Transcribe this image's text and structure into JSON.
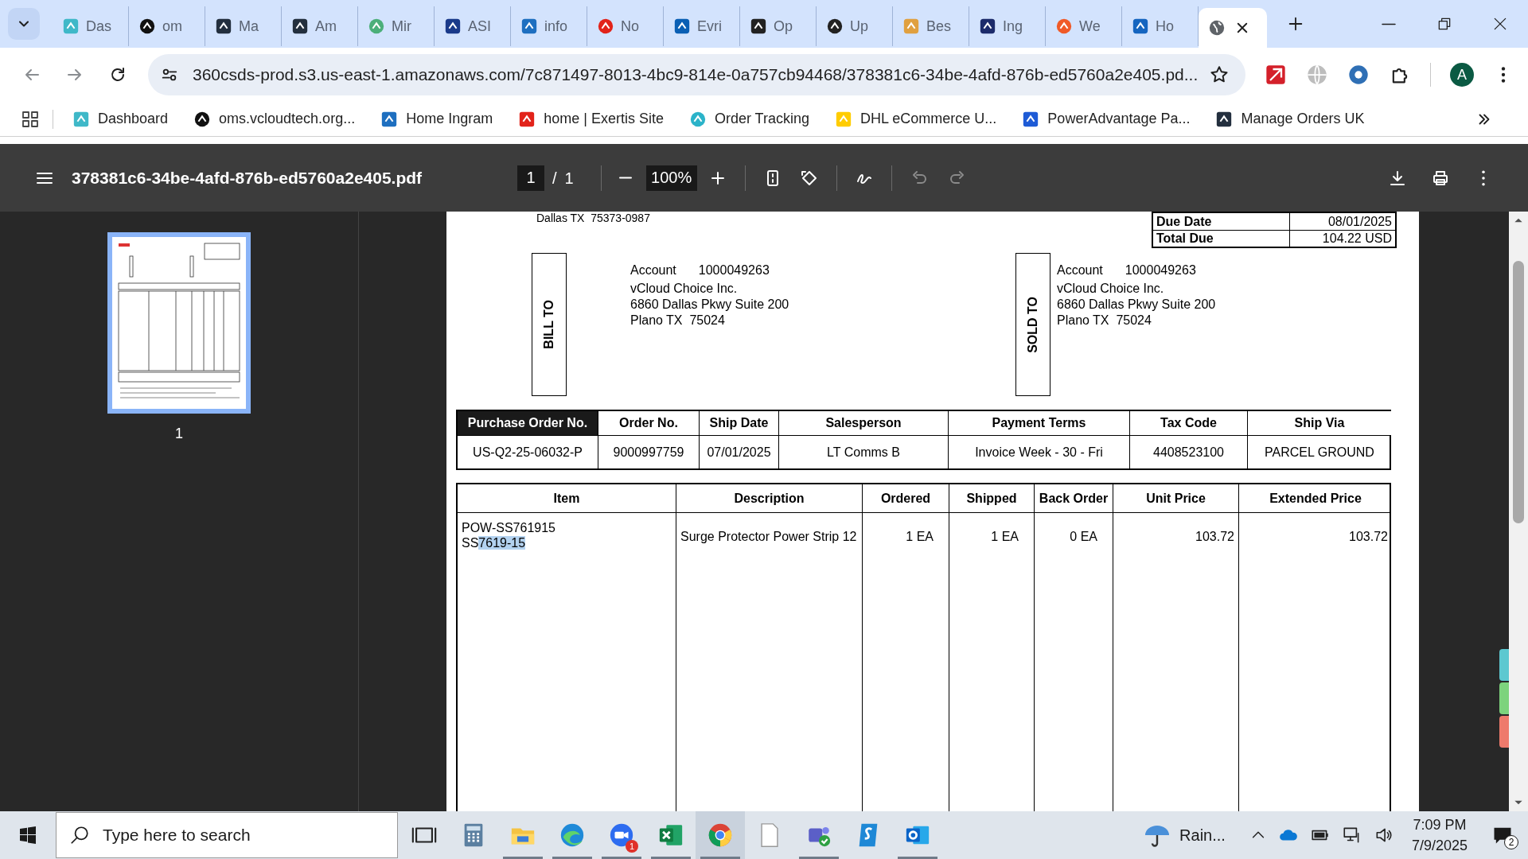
{
  "tabs": [
    {
      "label": "Das",
      "color": "#3fb8c8",
      "selected": false
    },
    {
      "label": "om",
      "color": "#111111",
      "selected": false
    },
    {
      "label": "Ma",
      "color": "#232f3e",
      "selected": false
    },
    {
      "label": "Am",
      "color": "#232f3e",
      "selected": false
    },
    {
      "label": "Mir",
      "color": "#4caf7a",
      "selected": false
    },
    {
      "label": "ASI",
      "color": "#1a3a8a",
      "selected": false
    },
    {
      "label": "info",
      "color": "#1e6fc0",
      "selected": false
    },
    {
      "label": "No",
      "color": "#e2231a",
      "selected": false
    },
    {
      "label": "Evri",
      "color": "#0a5fb4",
      "selected": false
    },
    {
      "label": "Op",
      "color": "#222222",
      "selected": false
    },
    {
      "label": "Up",
      "color": "#222222",
      "selected": false
    },
    {
      "label": "Bes",
      "color": "#e0a040",
      "selected": false
    },
    {
      "label": "Ing",
      "color": "#1c2b6b",
      "selected": false
    },
    {
      "label": "We",
      "color": "#f05a28",
      "selected": false
    },
    {
      "label": "Ho",
      "color": "#1565c0",
      "selected": false
    },
    {
      "color": "#5f6368",
      "selected": true
    }
  ],
  "address_bar": {
    "url": "360csds-prod.s3.us-east-1.amazonaws.com/7c871497-8013-4bc9-814e-0a757cb94468/378381c6-34be-4afd-876b-ed5760a2e405.pd..."
  },
  "profile": {
    "initial": "A"
  },
  "bookmarks": [
    {
      "label": "Dashboard",
      "color": "#3fb8c8"
    },
    {
      "label": "oms.vcloudtech.org...",
      "color": "#111111"
    },
    {
      "label": "Home Ingram",
      "color": "#1e6fc0"
    },
    {
      "label": "home | Exertis Site",
      "color": "#e2231a"
    },
    {
      "label": "Order Tracking",
      "color": "#2bb3c9"
    },
    {
      "label": "DHL eCommerce U...",
      "color": "#ffcc00"
    },
    {
      "label": "PowerAdvantage Pa...",
      "color": "#1e5bd6"
    },
    {
      "label": "Manage Orders UK",
      "color": "#232f3e"
    }
  ],
  "pdf_toolbar": {
    "file_name": "378381c6-34be-4afd-876b-ed5760a2e405.pdf",
    "page": "1",
    "page_separator": "/",
    "page_count": "1",
    "zoom": "100%"
  },
  "thumbnails": [
    {
      "page_label": "1",
      "selected": true
    }
  ],
  "document": {
    "remit_line": "Dallas TX  75373-0987",
    "summary": [
      {
        "label": "Due Date",
        "value": "08/01/2025"
      },
      {
        "label": "Total Due",
        "value": "104.22 USD"
      }
    ],
    "parties": [
      {
        "heading": "BILL TO",
        "account_label": "Account",
        "account_number": "1000049263",
        "address_lines": [
          "vCloud Choice Inc.",
          "6860 Dallas Pkwy Suite 200",
          "Plano TX  75024"
        ]
      },
      {
        "heading": "SOLD TO",
        "account_label": "Account",
        "account_number": "1000049263",
        "address_lines": [
          "vCloud Choice Inc.",
          "6860 Dallas Pkwy Suite 200",
          "Plano TX  75024"
        ]
      }
    ],
    "order_table": {
      "columns": [
        {
          "label": "Purchase Order No.",
          "highlighted": true
        },
        {
          "label": "Order No.",
          "highlighted": false
        },
        {
          "label": "Ship Date",
          "highlighted": false
        },
        {
          "label": "Salesperson",
          "highlighted": false
        },
        {
          "label": "Payment Terms",
          "highlighted": false
        },
        {
          "label": "Tax Code",
          "highlighted": false
        },
        {
          "label": "Ship Via",
          "highlighted": false
        }
      ],
      "rows": [
        [
          "US-Q2-25-06032-P",
          "9000997759",
          "07/01/2025",
          "LT Comms B",
          "Invoice Week - 30 - Fri",
          "4408523100",
          "PARCEL GROUND"
        ]
      ]
    },
    "line_items": {
      "columns": [
        "Item",
        "Description",
        "Ordered",
        "Shipped",
        "Back Order",
        "Unit Price",
        "Extended Price"
      ],
      "rows": [
        {
          "item_lines": [
            {
              "text": "POW-SS761915"
            },
            {
              "text": "SS",
              "selected_text": "7619-15"
            }
          ],
          "description": "Surge Protector Power Strip 12",
          "ordered": "1 EA",
          "shipped": "1 EA",
          "back_order": "0 EA",
          "unit_price": "103.72",
          "extended_price": "103.72"
        }
      ]
    }
  },
  "side_tabs": [
    {
      "color": "#5cc8d0"
    },
    {
      "color": "#7dd37d"
    },
    {
      "color": "#ee7a6c"
    }
  ],
  "taskbar": {
    "search_placeholder": "Type here to search",
    "apps": [
      {
        "kind": "task-view",
        "running": false,
        "selected": false
      },
      {
        "kind": "calculator",
        "running": false,
        "selected": false
      },
      {
        "kind": "file-explorer",
        "running": true,
        "selected": false
      },
      {
        "kind": "edge",
        "running": true,
        "selected": false
      },
      {
        "kind": "zoom",
        "running": true,
        "selected": false,
        "badge": "1"
      },
      {
        "kind": "excel",
        "running": true,
        "selected": false
      },
      {
        "kind": "chrome",
        "running": true,
        "selected": true
      },
      {
        "kind": "notepad",
        "running": false,
        "selected": false
      },
      {
        "kind": "teams",
        "running": true,
        "selected": false
      },
      {
        "kind": "sync",
        "running": false,
        "selected": false
      },
      {
        "kind": "outlook",
        "running": true,
        "selected": false
      }
    ],
    "weather": "Rain...",
    "time": "7:09 PM",
    "date": "7/9/2025",
    "notifications": "2"
  }
}
